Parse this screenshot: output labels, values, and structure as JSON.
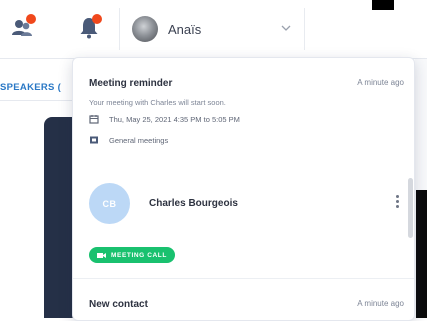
{
  "header": {
    "user_name": "Anaïs",
    "icons": {
      "people": "people-icon",
      "bell": "bell-icon",
      "chevron": "chevron-down-icon"
    },
    "badge_color": "#f0481c"
  },
  "background": {
    "tab_label": "SPEAKERS ("
  },
  "notifications": [
    {
      "title": "Meeting reminder",
      "time": "A minute ago",
      "text": "Your meeting with Charles will start soon.",
      "datetime": "Thu, May 25, 2021 4:35 PM to 5:05 PM",
      "category": "General meetings",
      "contact": {
        "initials": "CB",
        "name": "Charles Bourgeois"
      },
      "button_label": "MEETING CALL",
      "button_color": "#19c16f"
    },
    {
      "title": "New contact",
      "time": "A minute ago"
    }
  ]
}
